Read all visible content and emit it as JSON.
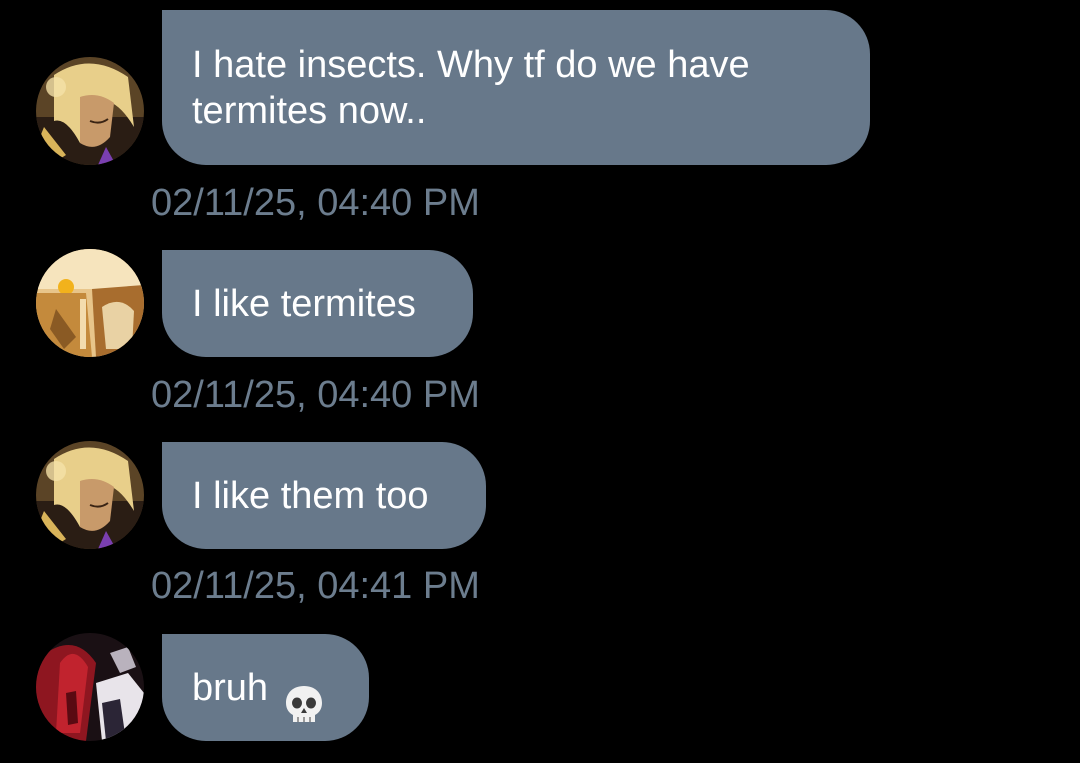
{
  "colors": {
    "background": "#000000",
    "bubble": "#67788a",
    "bubble_text": "#ffffff",
    "timestamp": "#6c7d8e"
  },
  "messages": [
    {
      "avatar": "blonde-character-avatar",
      "text": "I hate insects. Why tf do we have\ntermites now..",
      "time": "02/11/25, 04:40 PM"
    },
    {
      "avatar": "golden-scene-avatar",
      "text": "I like termites",
      "time": "02/11/25, 04:40 PM"
    },
    {
      "avatar": "blonde-character-avatar",
      "text": "I like them too",
      "time": "02/11/25, 04:41 PM"
    },
    {
      "avatar": "red-haired-character-avatar",
      "text": "bruh",
      "emoji": "skull-emoji"
    }
  ]
}
